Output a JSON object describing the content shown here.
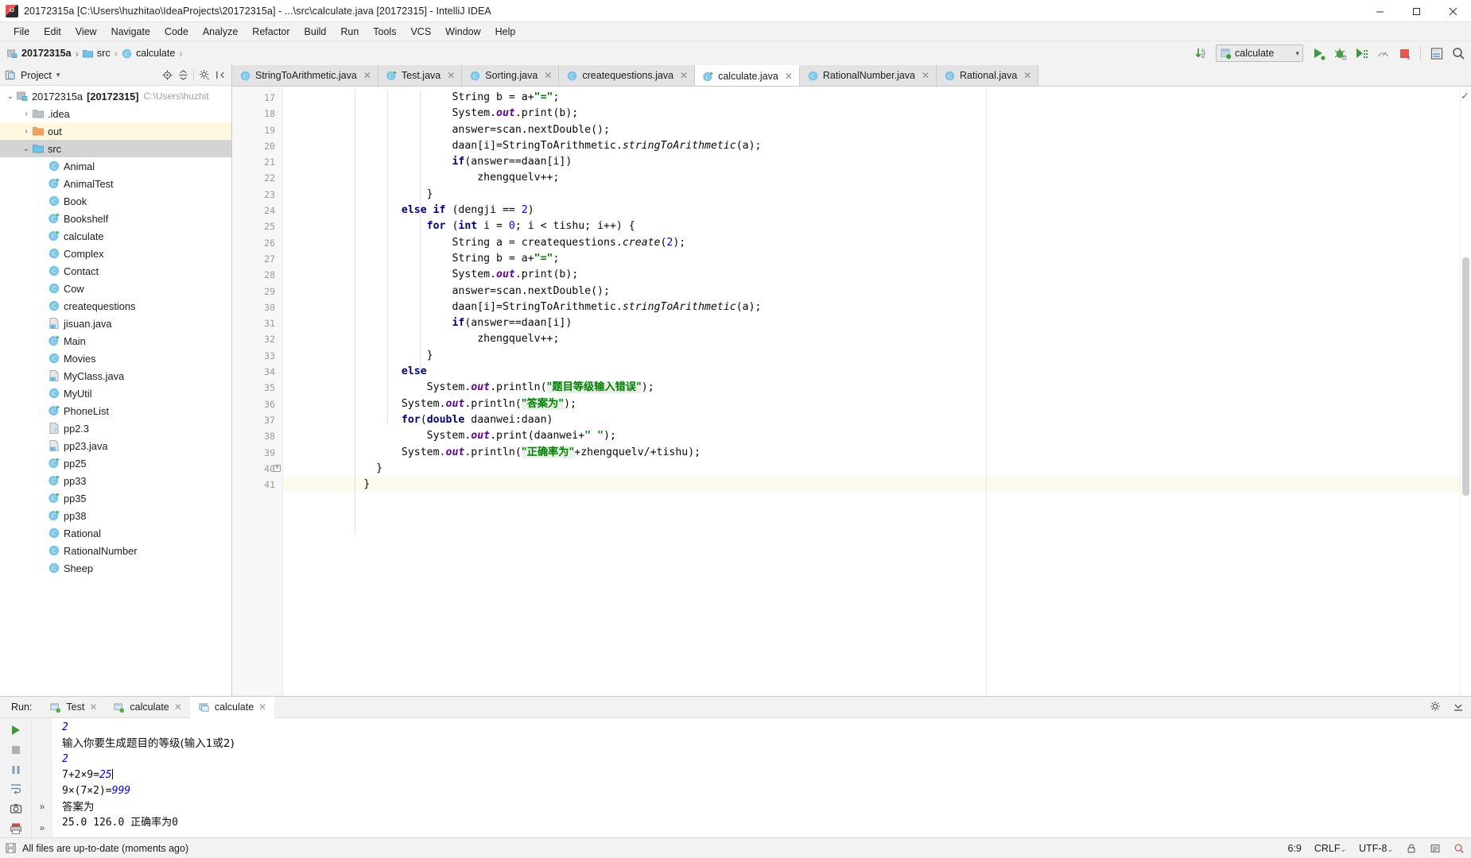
{
  "window": {
    "title": "20172315a [C:\\Users\\huzhitao\\IdeaProjects\\20172315a] - ...\\src\\calculate.java [20172315] - IntelliJ IDEA",
    "app_icon": "intellij-idea-logo",
    "minimize": "–",
    "maximize": "☐",
    "close": "✕"
  },
  "menu": {
    "items": [
      "File",
      "Edit",
      "View",
      "Navigate",
      "Code",
      "Analyze",
      "Refactor",
      "Build",
      "Run",
      "Tools",
      "VCS",
      "Window",
      "Help"
    ]
  },
  "navbar": {
    "breadcrumbs": [
      {
        "label": "20172315a",
        "icon": "module-icon",
        "bold": true
      },
      {
        "label": "src",
        "icon": "source-folder-icon",
        "bold": false
      },
      {
        "label": "calculate",
        "icon": "java-class-icon",
        "bold": false
      }
    ],
    "separator": "›",
    "run_config": "calculate",
    "run_config_icon": "java-class-run-icon",
    "toolbar_icons": [
      "update-project-icon",
      "run-icon",
      "debug-icon",
      "run-coverage-icon",
      "profile-icon",
      "stop-icon",
      "search-everywhere-icon",
      "find-icon"
    ]
  },
  "sidebar": {
    "header": {
      "title": "Project",
      "icon": "project-view-icon",
      "dropdown_caret": "▾",
      "actions": [
        "locate-icon",
        "collapse-all-icon",
        "settings-icon",
        "hide-icon"
      ]
    },
    "tree": [
      {
        "label": "20172315a",
        "badge": "[20172315]",
        "path": "C:\\Users\\huzhit",
        "icon": "module-icon",
        "twist": "⌄",
        "depth": 0,
        "highlight": "none"
      },
      {
        "label": ".idea",
        "icon": "folder-icon",
        "twist": "›",
        "depth": 1,
        "highlight": "none"
      },
      {
        "label": "out",
        "icon": "folder-orange-icon",
        "twist": "›",
        "depth": 1,
        "highlight": "yellow"
      },
      {
        "label": "src",
        "icon": "source-folder-icon",
        "twist": "⌄",
        "depth": 1,
        "highlight": "gray"
      },
      {
        "label": "Animal",
        "icon": "java-class-icon",
        "twist": "",
        "depth": 2,
        "highlight": "none"
      },
      {
        "label": "AnimalTest",
        "icon": "java-class-run-icon",
        "twist": "",
        "depth": 2,
        "highlight": "none"
      },
      {
        "label": "Book",
        "icon": "java-class-icon",
        "twist": "",
        "depth": 2,
        "highlight": "none"
      },
      {
        "label": "Bookshelf",
        "icon": "java-class-run-icon",
        "twist": "",
        "depth": 2,
        "highlight": "none"
      },
      {
        "label": "calculate",
        "icon": "java-class-run-icon",
        "twist": "",
        "depth": 2,
        "highlight": "none"
      },
      {
        "label": "Complex",
        "icon": "java-class-icon",
        "twist": "",
        "depth": 2,
        "highlight": "none"
      },
      {
        "label": "Contact",
        "icon": "java-class-icon",
        "twist": "",
        "depth": 2,
        "highlight": "none"
      },
      {
        "label": "Cow",
        "icon": "java-class-icon",
        "twist": "",
        "depth": 2,
        "highlight": "none"
      },
      {
        "label": "createquestions",
        "icon": "java-class-icon",
        "twist": "",
        "depth": 2,
        "highlight": "none"
      },
      {
        "label": "jisuan.java",
        "icon": "java-file-icon",
        "twist": "",
        "depth": 2,
        "highlight": "none"
      },
      {
        "label": "Main",
        "icon": "java-class-run-icon",
        "twist": "",
        "depth": 2,
        "highlight": "none"
      },
      {
        "label": "Movies",
        "icon": "java-class-icon",
        "twist": "",
        "depth": 2,
        "highlight": "none"
      },
      {
        "label": "MyClass.java",
        "icon": "java-file-icon",
        "twist": "",
        "depth": 2,
        "highlight": "none"
      },
      {
        "label": "MyUtil",
        "icon": "java-class-icon",
        "twist": "",
        "depth": 2,
        "highlight": "none"
      },
      {
        "label": "PhoneList",
        "icon": "java-class-run-icon",
        "twist": "",
        "depth": 2,
        "highlight": "none"
      },
      {
        "label": "pp2.3",
        "icon": "unknown-file-icon",
        "twist": "",
        "depth": 2,
        "highlight": "none"
      },
      {
        "label": "pp23.java",
        "icon": "java-file-icon",
        "twist": "",
        "depth": 2,
        "highlight": "none"
      },
      {
        "label": "pp25",
        "icon": "java-class-run-icon",
        "twist": "",
        "depth": 2,
        "highlight": "none"
      },
      {
        "label": "pp33",
        "icon": "java-class-run-icon",
        "twist": "",
        "depth": 2,
        "highlight": "none"
      },
      {
        "label": "pp35",
        "icon": "java-class-run-icon",
        "twist": "",
        "depth": 2,
        "highlight": "none"
      },
      {
        "label": "pp38",
        "icon": "java-class-run-icon",
        "twist": "",
        "depth": 2,
        "highlight": "none"
      },
      {
        "label": "Rational",
        "icon": "java-class-icon",
        "twist": "",
        "depth": 2,
        "highlight": "none"
      },
      {
        "label": "RationalNumber",
        "icon": "java-class-icon",
        "twist": "",
        "depth": 2,
        "highlight": "none"
      },
      {
        "label": "Sheep",
        "icon": "java-class-icon",
        "twist": "",
        "depth": 2,
        "highlight": "none"
      }
    ]
  },
  "editor": {
    "tabs": [
      {
        "label": "StringToArithmetic.java",
        "icon": "java-class-icon",
        "active": false
      },
      {
        "label": "Test.java",
        "icon": "java-class-run-icon",
        "active": false
      },
      {
        "label": "Sorting.java",
        "icon": "java-class-icon",
        "active": false
      },
      {
        "label": "createquestions.java",
        "icon": "java-class-icon",
        "active": false
      },
      {
        "label": "calculate.java",
        "icon": "java-class-run-icon",
        "active": true
      },
      {
        "label": "RationalNumber.java",
        "icon": "java-class-icon",
        "active": false
      },
      {
        "label": "Rational.java",
        "icon": "java-class-icon",
        "active": false
      }
    ],
    "close_glyph": "✕",
    "first_line_number": 17,
    "lines": [
      {
        "n": 17,
        "indent": 26,
        "tokens": [
          {
            "t": "String b = a+",
            "c": "plain"
          },
          {
            "t": "\"=\"",
            "c": "str"
          },
          {
            "t": ";",
            "c": "plain"
          }
        ]
      },
      {
        "n": 18,
        "indent": 26,
        "tokens": [
          {
            "t": "System.",
            "c": "plain"
          },
          {
            "t": "out",
            "c": "statp"
          },
          {
            "t": ".print(b);",
            "c": "plain"
          }
        ]
      },
      {
        "n": 19,
        "indent": 26,
        "tokens": [
          {
            "t": "answer=scan.nextDouble();",
            "c": "plain"
          }
        ]
      },
      {
        "n": 20,
        "indent": 26,
        "tokens": [
          {
            "t": "daan[i]=StringToArithmetic.",
            "c": "plain"
          },
          {
            "t": "stringToArithmetic",
            "c": "meth"
          },
          {
            "t": "(a);",
            "c": "plain"
          }
        ]
      },
      {
        "n": 21,
        "indent": 26,
        "tokens": [
          {
            "t": "if",
            "c": "kw"
          },
          {
            "t": "(answer==daan[i])",
            "c": "plain"
          }
        ]
      },
      {
        "n": 22,
        "indent": 30,
        "tokens": [
          {
            "t": "zhengquelv++;",
            "c": "plain"
          }
        ]
      },
      {
        "n": 23,
        "indent": 22,
        "tokens": [
          {
            "t": "}",
            "c": "plain"
          }
        ]
      },
      {
        "n": 24,
        "indent": 18,
        "tokens": [
          {
            "t": "else if",
            "c": "kw"
          },
          {
            "t": " (dengji == ",
            "c": "plain"
          },
          {
            "t": "2",
            "c": "num"
          },
          {
            "t": ")",
            "c": "plain"
          }
        ]
      },
      {
        "n": 25,
        "indent": 22,
        "tokens": [
          {
            "t": "for",
            "c": "kw"
          },
          {
            "t": " (",
            "c": "plain"
          },
          {
            "t": "int",
            "c": "kw"
          },
          {
            "t": " i = ",
            "c": "plain"
          },
          {
            "t": "0",
            "c": "num"
          },
          {
            "t": "; i < tishu; i++) {",
            "c": "plain"
          }
        ]
      },
      {
        "n": 26,
        "indent": 26,
        "tokens": [
          {
            "t": "String a = createquestions.",
            "c": "plain"
          },
          {
            "t": "create",
            "c": "meth"
          },
          {
            "t": "(",
            "c": "plain"
          },
          {
            "t": "2",
            "c": "num"
          },
          {
            "t": ");",
            "c": "plain"
          }
        ]
      },
      {
        "n": 27,
        "indent": 26,
        "tokens": [
          {
            "t": "String b = a+",
            "c": "plain"
          },
          {
            "t": "\"=\"",
            "c": "str"
          },
          {
            "t": ";",
            "c": "plain"
          }
        ]
      },
      {
        "n": 28,
        "indent": 26,
        "tokens": [
          {
            "t": "System.",
            "c": "plain"
          },
          {
            "t": "out",
            "c": "statp"
          },
          {
            "t": ".print(b);",
            "c": "plain"
          }
        ]
      },
      {
        "n": 29,
        "indent": 26,
        "tokens": [
          {
            "t": "answer=scan.nextDouble();",
            "c": "plain"
          }
        ]
      },
      {
        "n": 30,
        "indent": 26,
        "tokens": [
          {
            "t": "daan[i]=StringToArithmetic.",
            "c": "plain"
          },
          {
            "t": "stringToArithmetic",
            "c": "meth"
          },
          {
            "t": "(a);",
            "c": "plain"
          }
        ]
      },
      {
        "n": 31,
        "indent": 26,
        "tokens": [
          {
            "t": "if",
            "c": "kw"
          },
          {
            "t": "(answer==daan[i])",
            "c": "plain"
          }
        ]
      },
      {
        "n": 32,
        "indent": 30,
        "tokens": [
          {
            "t": "zhengquelv++;",
            "c": "plain"
          }
        ]
      },
      {
        "n": 33,
        "indent": 22,
        "tokens": [
          {
            "t": "}",
            "c": "plain"
          }
        ]
      },
      {
        "n": 34,
        "indent": 18,
        "tokens": [
          {
            "t": "else",
            "c": "kw"
          }
        ]
      },
      {
        "n": 35,
        "indent": 22,
        "tokens": [
          {
            "t": "System.",
            "c": "plain"
          },
          {
            "t": "out",
            "c": "statp"
          },
          {
            "t": ".println(",
            "c": "plain"
          },
          {
            "t": "\"题目等级输入错误\"",
            "c": "str"
          },
          {
            "t": ");",
            "c": "plain"
          }
        ]
      },
      {
        "n": 36,
        "indent": 18,
        "tokens": [
          {
            "t": "System.",
            "c": "plain"
          },
          {
            "t": "out",
            "c": "statp"
          },
          {
            "t": ".println(",
            "c": "plain"
          },
          {
            "t": "\"答案为\"",
            "c": "str"
          },
          {
            "t": ");",
            "c": "plain"
          }
        ]
      },
      {
        "n": 37,
        "indent": 18,
        "tokens": [
          {
            "t": "for",
            "c": "kw"
          },
          {
            "t": "(",
            "c": "plain"
          },
          {
            "t": "double",
            "c": "kw"
          },
          {
            "t": " daanwei:daan)",
            "c": "plain"
          }
        ]
      },
      {
        "n": 38,
        "indent": 22,
        "tokens": [
          {
            "t": "System.",
            "c": "plain"
          },
          {
            "t": "out",
            "c": "statp"
          },
          {
            "t": ".print(daanwei+",
            "c": "plain"
          },
          {
            "t": "\" \"",
            "c": "str"
          },
          {
            "t": ");",
            "c": "plain"
          }
        ]
      },
      {
        "n": 39,
        "indent": 18,
        "tokens": [
          {
            "t": "System.",
            "c": "plain"
          },
          {
            "t": "out",
            "c": "statp"
          },
          {
            "t": ".println(",
            "c": "plain"
          },
          {
            "t": "\"正确率为\"",
            "c": "str"
          },
          {
            "t": "+zhengquelv/+tishu);",
            "c": "plain"
          }
        ]
      },
      {
        "n": 40,
        "indent": 14,
        "tokens": [
          {
            "t": "}",
            "c": "plain"
          }
        ]
      },
      {
        "n": 41,
        "indent": 12,
        "tokens": [
          {
            "t": "}",
            "c": "plain"
          }
        ],
        "caret": true
      }
    ]
  },
  "run_panel": {
    "label": "Run:",
    "tabs": [
      {
        "label": "Test",
        "icon": "run-config-icon",
        "active": false
      },
      {
        "label": "calculate",
        "icon": "run-config-icon",
        "active": false
      },
      {
        "label": "calculate",
        "icon": "run-config-active-icon",
        "active": true
      }
    ],
    "close_glyph": "✕",
    "toolbar_left": [
      "rerun-icon",
      "stop-icon",
      "pause-icon",
      "wrap-text-icon",
      "screenshot-icon",
      "print-icon"
    ],
    "toolbar_right": [
      "settings-icon",
      "hide-panel-icon"
    ],
    "expand_glyph": "»",
    "console": [
      {
        "text": "2",
        "style": "input"
      },
      {
        "text": "输入你要生成题目的等级(输入1或2)",
        "style": "cjk"
      },
      {
        "text": "2",
        "style": "input"
      },
      {
        "text": "7+2×9=25",
        "style": "mixed-input",
        "prefix": "7+2×9=",
        "value": "25",
        "caret": true
      },
      {
        "text": "9×(7×2)=999",
        "style": "mixed-input",
        "prefix": "9×(7×2)=",
        "value": "999"
      },
      {
        "text": "答案为",
        "style": "cjk"
      },
      {
        "text": "25.0 126.0 正确率为0",
        "style": "plain"
      }
    ]
  },
  "statusbar": {
    "message": "All files are up-to-date (moments ago)",
    "message_icon": "save-all-icon",
    "caret_position": "6:9",
    "line_separator": "CRLF",
    "line_separator_caret": "⌄",
    "encoding": "UTF-8",
    "encoding_caret": "⌄",
    "right_icons": [
      "lock-icon",
      "event-log-icon",
      "analyze-icon"
    ]
  },
  "colors": {
    "accent_green": "#3c9a3c",
    "keyword_navy": "#000080",
    "string_green": "#008000",
    "number_blue": "#0000ff",
    "static_purple": "#660099",
    "highlight_yellow": "#fff8e1",
    "selection_gray": "#d4d4d4"
  }
}
